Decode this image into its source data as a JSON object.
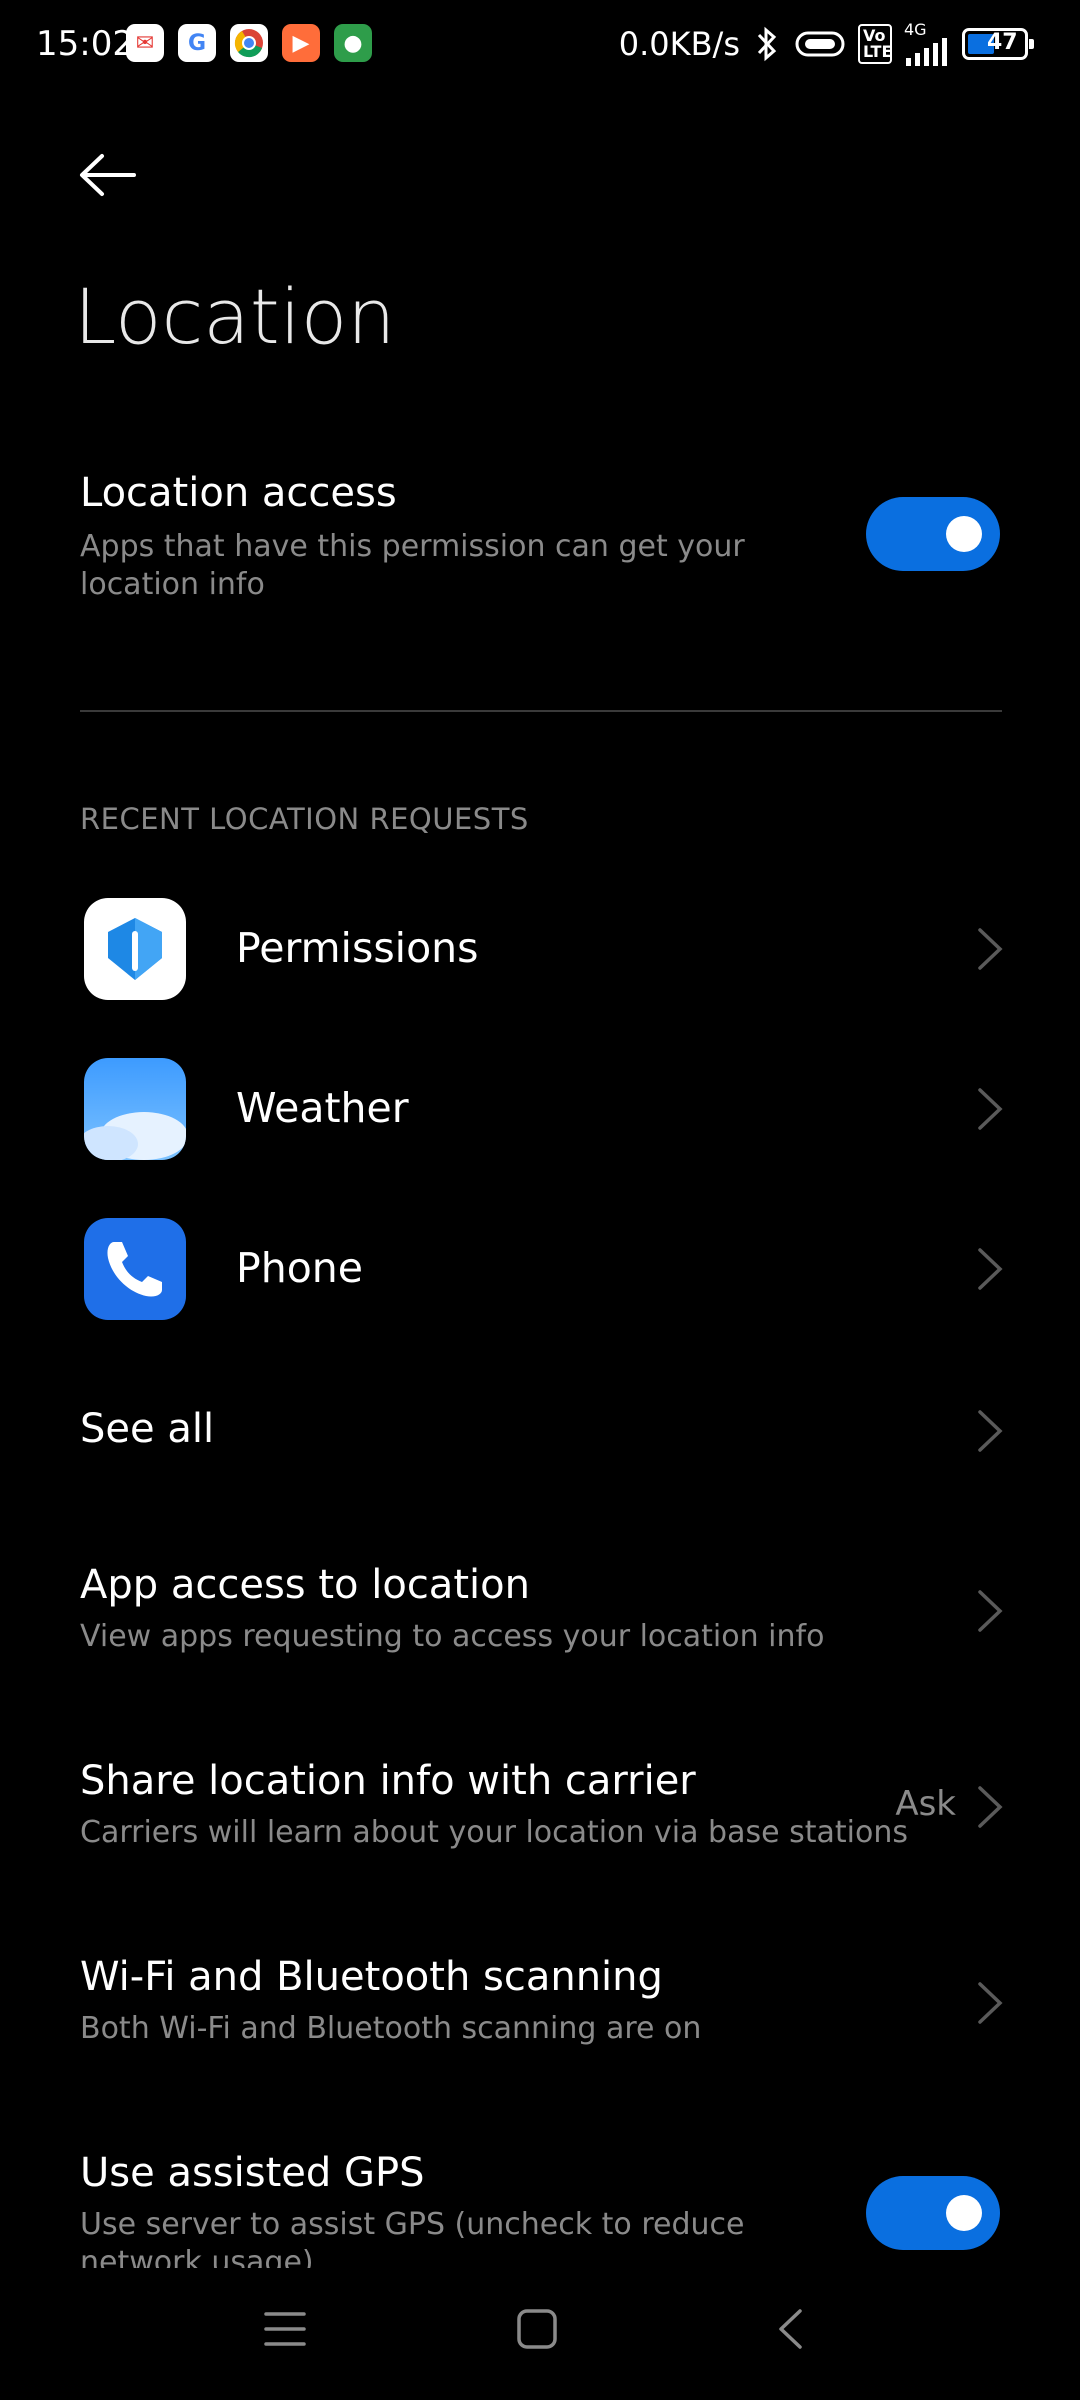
{
  "status_bar": {
    "time": "15:02",
    "network_speed": "0.0KB/s",
    "signal_type": "4G",
    "volte_label": "Vo LTE",
    "battery_level": "47",
    "app_icons": [
      "message-icon",
      "google-icon",
      "chrome-icon",
      "video-icon",
      "paw-icon"
    ]
  },
  "header": {
    "title": "Location"
  },
  "location_access": {
    "title": "Location access",
    "subtitle": "Apps that have this permission can get your location info",
    "enabled": true
  },
  "recent_requests": {
    "section_label": "RECENT LOCATION REQUESTS",
    "apps": [
      {
        "label": "Permissions",
        "icon": "shield-icon"
      },
      {
        "label": "Weather",
        "icon": "weather-cloud-icon"
      },
      {
        "label": "Phone",
        "icon": "phone-icon"
      }
    ],
    "see_all_label": "See all"
  },
  "settings": [
    {
      "title": "App access to location",
      "subtitle": "View apps requesting to access your location info"
    },
    {
      "title": "Share location info with carrier",
      "subtitle": "Carriers will learn about your location via base stations",
      "value": "Ask"
    },
    {
      "title": "Wi-Fi and Bluetooth scanning",
      "subtitle": "Both Wi-Fi and Bluetooth scanning are on"
    },
    {
      "title": "Use assisted GPS",
      "subtitle": "Use server to assist GPS (uncheck to reduce network usage)",
      "enabled": true
    }
  ],
  "colors": {
    "accent": "#0a6fe0",
    "background": "#000000",
    "secondary_text": "#8a8a8a"
  }
}
